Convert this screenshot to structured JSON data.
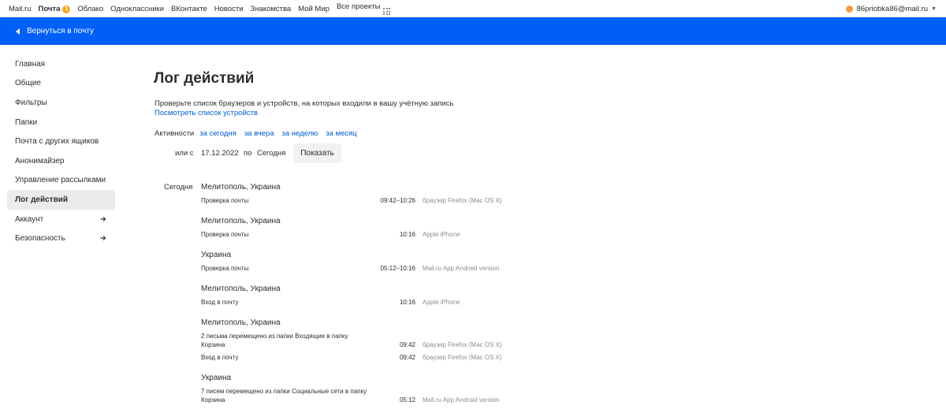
{
  "portal": {
    "links": [
      "Mail.ru",
      "Почта",
      "Облако",
      "Одноклассники",
      "ВКонтакте",
      "Новости",
      "Знакомства",
      "Мой Мир",
      "Все проекты"
    ],
    "mail_badge": "1",
    "account_email": "86priobka86@mail.ru"
  },
  "topbar": {
    "back_label": "Вернуться в почту"
  },
  "sidebar": {
    "items": [
      {
        "label": "Главная"
      },
      {
        "label": "Общие"
      },
      {
        "label": "Фильтры"
      },
      {
        "label": "Папки"
      },
      {
        "label": "Почта с других ящиков"
      },
      {
        "label": "Анонимайзер"
      },
      {
        "label": "Управление рассылками"
      },
      {
        "label": "Лог действий"
      },
      {
        "label": "Аккаунт"
      },
      {
        "label": "Безопасность"
      }
    ],
    "active_index": 7
  },
  "main": {
    "title": "Лог действий",
    "description": "Проверьте список браузеров и устройств, на которых входили в вашу учётную запись",
    "devices_link": "Посмотреть список устройств",
    "filter_label": "Активности",
    "filters": [
      "за сегодня",
      "за вчера",
      "за неделю",
      "за месяц"
    ],
    "range_prefix": "или с",
    "date_from": "17.12.2022",
    "range_to_word": "по",
    "date_to": "Сегодня",
    "show_button": "Показать",
    "day_label": "Сегодня"
  },
  "log": [
    {
      "location": "Мелитополь, Украина",
      "entries": [
        {
          "action": "Проверка почты",
          "time": "09:42–10:26",
          "device": "браузер Firefox (Mac OS X)"
        }
      ]
    },
    {
      "location": "Мелитополь, Украина",
      "entries": [
        {
          "action": "Проверка почты",
          "time": "10:16",
          "device": "Apple iPhone"
        }
      ]
    },
    {
      "location": "Украина",
      "entries": [
        {
          "action": "Проверка почты",
          "time": "05:12–10:16",
          "device": "Mail.ru App Android version"
        }
      ]
    },
    {
      "location": "Мелитополь, Украина",
      "entries": [
        {
          "action": "Вход в почту",
          "time": "10:16",
          "device": "Apple iPhone"
        }
      ]
    },
    {
      "location": "Мелитополь, Украина",
      "entries": [
        {
          "action_line1": "2 письма перемещено из папки Входящие в папку",
          "action": "Корзина",
          "time": "09:42",
          "device": "браузер Firefox (Mac OS X)"
        },
        {
          "action": "Вход в почту",
          "time": "09:42",
          "device": "браузер Firefox (Mac OS X)"
        }
      ]
    },
    {
      "location": "Украина",
      "entries": [
        {
          "action_line1": "7 писем перемещено из папки Социальные сети в папку",
          "action": "Корзина",
          "time": "05:12",
          "device": "Mail.ru App Android version"
        }
      ]
    }
  ]
}
